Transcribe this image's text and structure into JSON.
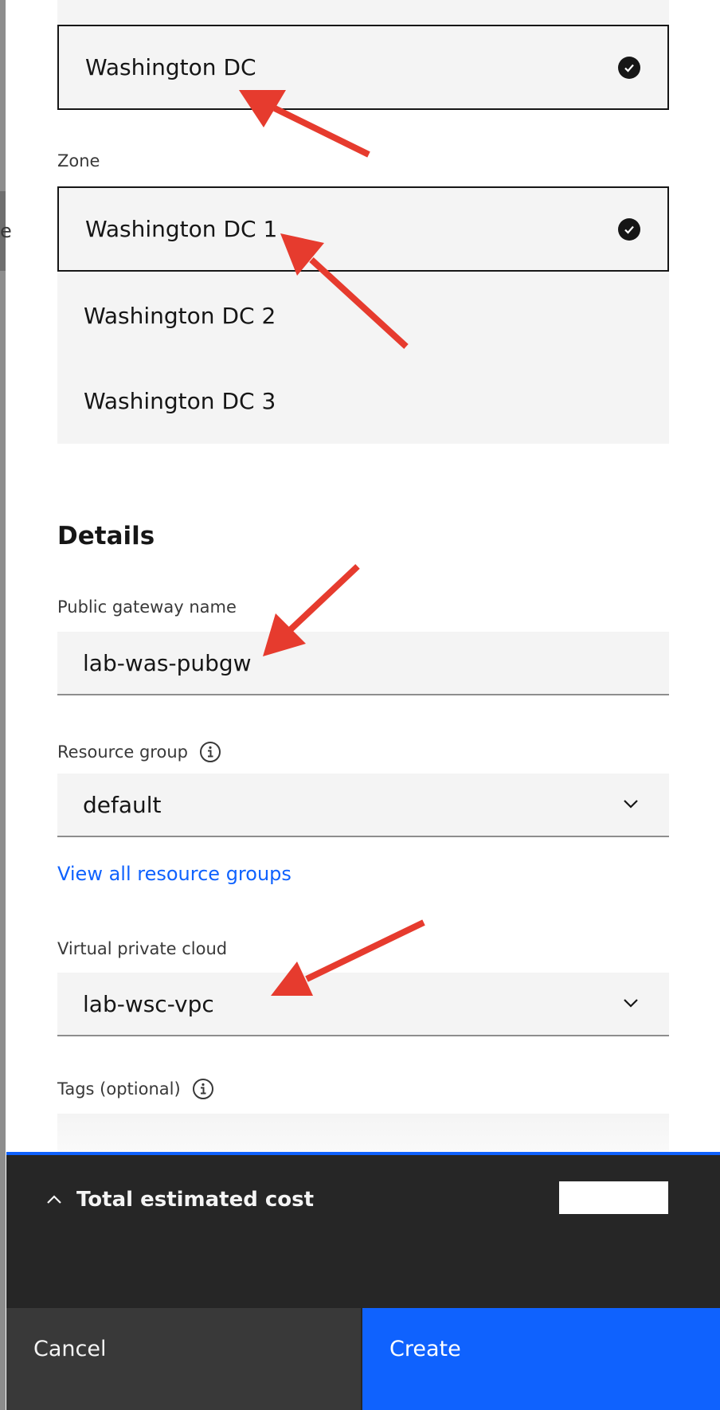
{
  "region": {
    "selected": "Washington DC"
  },
  "zone": {
    "label": "Zone",
    "options": [
      "Washington DC 1",
      "Washington DC 2",
      "Washington DC 3"
    ]
  },
  "details": {
    "title": "Details",
    "gateway_name": {
      "label": "Public gateway name",
      "value": "lab-was-pubgw"
    },
    "resource_group": {
      "label": "Resource group",
      "value": "default"
    },
    "view_all_link": "View all resource groups",
    "vpc": {
      "label": "Virtual private cloud",
      "value": "lab-wsc-vpc"
    },
    "tags": {
      "label": "Tags (optional)"
    }
  },
  "footer": {
    "cost_label": "Total estimated cost",
    "cancel_label": "Cancel",
    "create_label": "Create"
  },
  "left_edge_glyph": "e",
  "colors": {
    "accent": "#0f62fe",
    "annotation": "#e63b2e",
    "footer_bg": "#262626"
  },
  "icons": [
    "checkmark-filled-icon",
    "chevron-down-icon",
    "information-icon",
    "chevron-up-icon"
  ]
}
